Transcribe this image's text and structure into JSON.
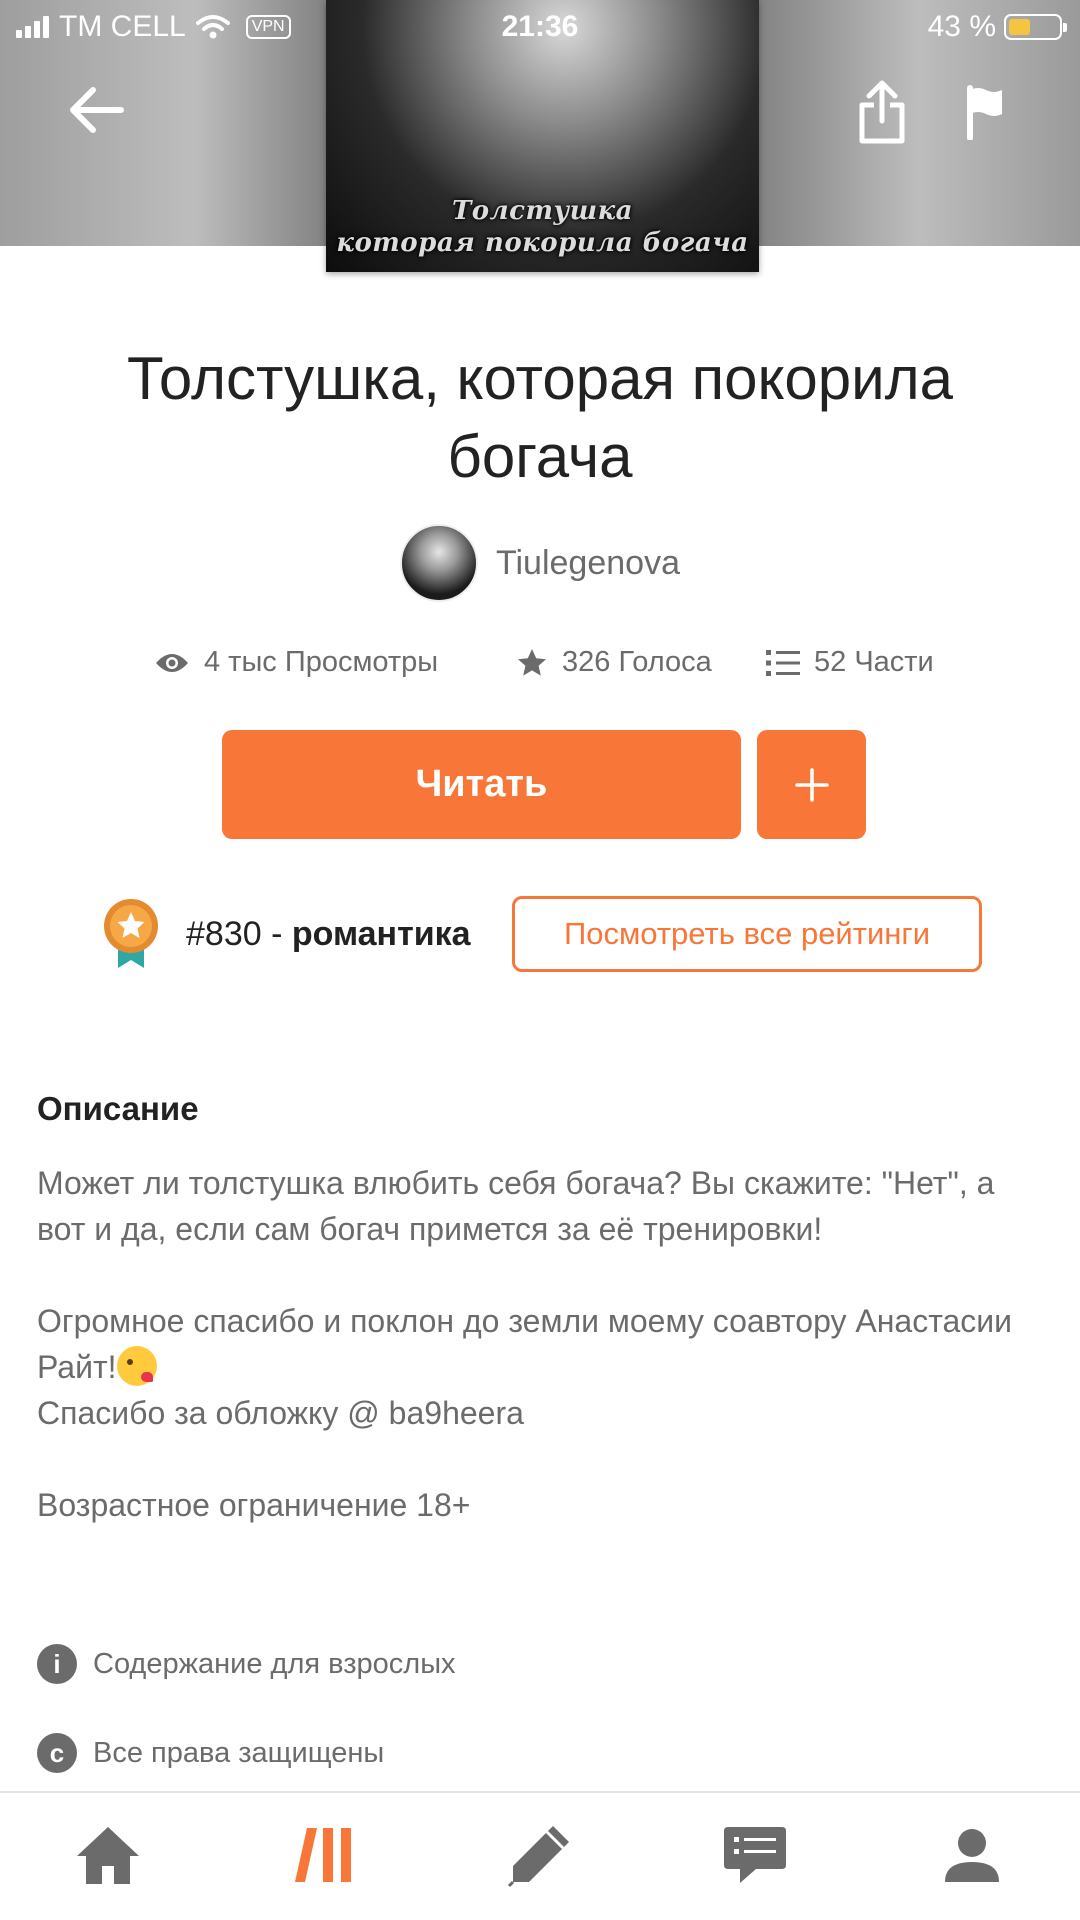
{
  "status_bar": {
    "carrier": "TM CELL",
    "vpn": "VPN",
    "time": "21:36",
    "battery_percent": "43 %",
    "battery_level": 0.43
  },
  "cover": {
    "line1": "Толстушка",
    "line2": "которая покорила богача"
  },
  "header_icons": [
    "arrow-left-icon",
    "share-icon",
    "flag-icon"
  ],
  "story": {
    "title": "Толстушка, которая покорила богача",
    "author": "Tiulegenova"
  },
  "stats": {
    "views": "4 тыс Просмотры",
    "votes": "326 Голоса",
    "parts": "52 Части"
  },
  "actions": {
    "read_label": "Читать",
    "add_label": "+"
  },
  "ranking": {
    "rank": "#830",
    "separator": " - ",
    "category": "романтика",
    "all_rankings_label": "Посмотреть все рейтинги"
  },
  "description": {
    "heading": "Описание",
    "para1": "Может ли толстушка влюбить себя богача? Вы скажите: \"Нет\", а вот и да, если сам богач примется за её тренировки!",
    "line2a": "Огромное  спасибо и поклон до земли моему соавтору Анастасии Райт!",
    "line2b": "Спасибо за обложку @ ba9heera",
    "age": "Возрастное ограничение 18+"
  },
  "meta": {
    "adult_content": "Содержание для взрослых",
    "copyright": "Все права защищены"
  },
  "colors": {
    "accent": "#f87637",
    "text_primary": "#222222",
    "text_secondary": "#6b6b6b"
  },
  "bottom_nav": [
    "home-icon",
    "library-icon",
    "write-icon",
    "messages-icon",
    "profile-icon"
  ]
}
